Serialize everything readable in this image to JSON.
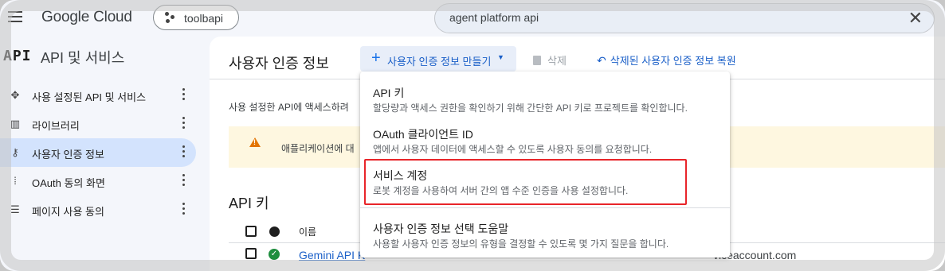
{
  "topbar": {
    "logo": "Google Cloud",
    "project": "toolbapi",
    "search_value": "agent platform api"
  },
  "sidebar": {
    "logo": "API",
    "title": "API 및 서비스",
    "items": [
      {
        "label": "사용 설정된 API 및 서비스",
        "icon": "api-diamond-icon"
      },
      {
        "label": "라이브러리",
        "icon": "library-icon"
      },
      {
        "label": "사용자 인증 정보",
        "icon": "key-icon",
        "active": true
      },
      {
        "label": "OAuth 동의 화면",
        "icon": "oauth-dots-icon"
      },
      {
        "label": "페이지 사용 동의",
        "icon": "settings-list-icon"
      }
    ]
  },
  "main": {
    "title": "사용자 인증 정보",
    "create_label": "사용자 인증 정보 만들기",
    "delete_label": "삭제",
    "restore_label": "삭제된 사용자 인증 정보 복원",
    "info_text": "사용 설정한 API에 액세스하려",
    "warning_text": "애플리케이션에 대",
    "section_title": "API 키",
    "table": {
      "column_name": "이름",
      "rows": [
        {
          "name": "Gemini API K",
          "email": "viceaccount.com"
        }
      ]
    }
  },
  "menu": {
    "items": [
      {
        "title": "API 키",
        "desc": "할당량과 액세스 권한을 확인하기 위해 간단한 API 키로 프로젝트를 확인합니다."
      },
      {
        "title": "OAuth 클라이언트 ID",
        "desc": "앱에서 사용자 데이터에 액세스할 수 있도록 사용자 동의를 요청합니다."
      },
      {
        "title": "서비스 계정",
        "desc": "로봇 계정을 사용하여 서버 간의 앱 수준 인증을 사용 설정합니다."
      },
      {
        "title": "사용자 인증 정보 선택 도움말",
        "desc": "사용할 사용자 인증 정보의 유형을 결정할 수 있도록 몇 가지 질문을 합니다."
      }
    ]
  },
  "colors": {
    "accent": "#1a73e8",
    "active_nav": "#d3e3fd",
    "highlight_border": "#e8252a",
    "warning_bg": "#fef7e0"
  }
}
